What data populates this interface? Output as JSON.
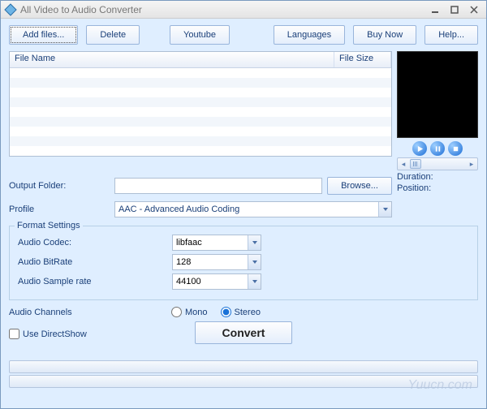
{
  "window": {
    "title": "All Video to Audio Converter"
  },
  "toolbar": {
    "add_files": "Add files...",
    "delete": "Delete",
    "youtube": "Youtube",
    "languages": "Languages",
    "buy_now": "Buy Now",
    "help": "Help..."
  },
  "filelist": {
    "col_name": "File Name",
    "col_size": "File Size",
    "rows": []
  },
  "preview": {
    "duration_label": "Duration:",
    "position_label": "Position:"
  },
  "output": {
    "label": "Output Folder:",
    "value": "",
    "browse": "Browse..."
  },
  "profile": {
    "label": "Profile",
    "value": "AAC - Advanced Audio Coding"
  },
  "format_settings": {
    "legend": "Format Settings",
    "codec_label": "Audio Codec:",
    "codec_value": "libfaac",
    "bitrate_label": "Audio BitRate",
    "bitrate_value": "128",
    "sample_label": "Audio Sample rate",
    "sample_value": "44100"
  },
  "channels": {
    "label": "Audio Channels",
    "mono": "Mono",
    "stereo": "Stereo",
    "selected": "stereo"
  },
  "directshow": {
    "label": "Use DirectShow",
    "checked": false
  },
  "convert": {
    "label": "Convert"
  },
  "watermark": "Yuucn.com"
}
